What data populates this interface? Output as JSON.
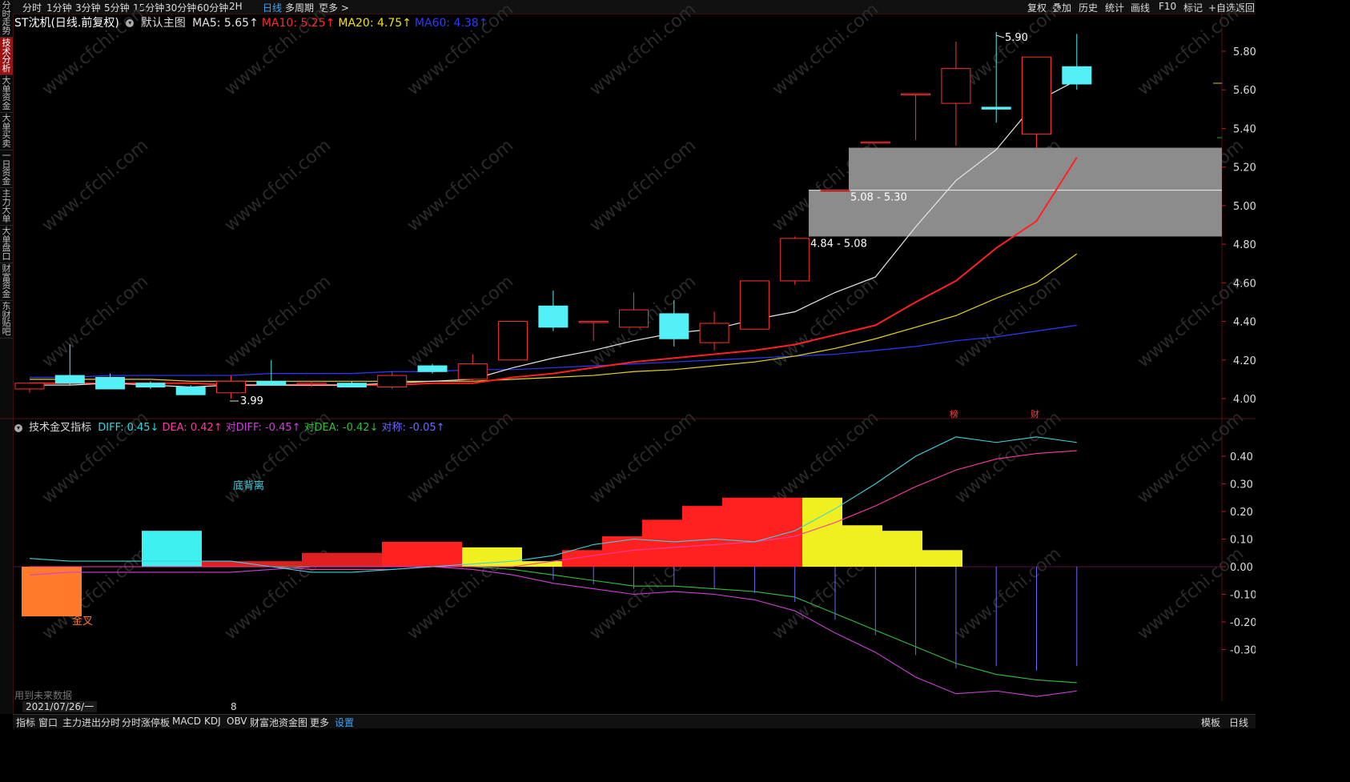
{
  "sidebar": {
    "tabs": [
      {
        "label": "分时走势",
        "active": false
      },
      {
        "label": "技术分析",
        "active": true
      },
      {
        "label": "大单资金",
        "active": false
      },
      {
        "label": "大单买卖",
        "active": false
      },
      {
        "label": "一日资金",
        "active": false
      },
      {
        "label": "主力大单",
        "active": false
      },
      {
        "label": "大单盘口",
        "active": false
      },
      {
        "label": "财富资金",
        "active": false
      },
      {
        "label": "东财贴吧",
        "active": false
      }
    ]
  },
  "toolbar": {
    "periods": [
      "分时",
      "1分钟",
      "3分钟",
      "5分钟",
      "15分钟",
      "30分钟",
      "60分钟",
      "2H",
      "日线",
      "多周期",
      "更多 >"
    ],
    "active_period": "日线",
    "right_tools": [
      "复权",
      "叠加",
      "历史",
      "统计",
      "画线",
      "F10",
      "标记",
      "+自选",
      "返回"
    ]
  },
  "main_chart": {
    "title": "ST沈机(日线.前复权)",
    "indicator_name": "默认主图",
    "ma": [
      {
        "label": "MA5: 5.65",
        "color": "#e6e6e6"
      },
      {
        "label": "MA10: 5.25",
        "color": "#ff2a2a"
      },
      {
        "label": "MA20: 4.75",
        "color": "#f3e01a"
      },
      {
        "label": "MA60: 4.38",
        "color": "#2b3bff"
      }
    ],
    "y_ticks": [
      "5.80",
      "5.60",
      "5.40",
      "5.20",
      "5.00",
      "4.80",
      "4.60",
      "4.40",
      "4.20",
      "4.00"
    ],
    "max_label": "5.90",
    "min_label": "3.99",
    "zone_labels": [
      "5.08 - 5.30",
      "4.84 - 5.08"
    ],
    "markers": [
      "榜",
      "财"
    ]
  },
  "sub_chart": {
    "title": "技术金叉指标",
    "values": [
      {
        "label": "DIFF: 0.45",
        "color": "#3ad4e0"
      },
      {
        "label": "DEA: 0.42",
        "color": "#ff3aa0"
      },
      {
        "label": "对DIFF: -0.45",
        "color": "#d040d8"
      },
      {
        "label": "对DEA: -0.42",
        "color": "#30c040"
      },
      {
        "label": "对称: -0.05",
        "color": "#6b6bff"
      }
    ],
    "y_ticks": [
      "0.40",
      "0.30",
      "0.20",
      "0.10",
      "0.00",
      "-0.10",
      "-0.20",
      "-0.30"
    ],
    "annotations": {
      "divergence": "底背离",
      "golden_cross": "金叉"
    }
  },
  "footer": {
    "future_note": "用到未来数据",
    "date": "2021/07/26/一",
    "date_tick": "8",
    "tabs": [
      "指标",
      "窗口",
      "主力进出分时",
      "分时涨停板",
      "MACD",
      "KDJ",
      "OBV",
      "财富池资金图",
      "更多",
      "设置"
    ],
    "active_tab": "设置",
    "right_labels": [
      "模板",
      "日线"
    ]
  },
  "watermark": "www.cfchi.com",
  "chart_data": [
    {
      "type": "candlestick",
      "title": "ST沈机(日线.前复权)",
      "ylim": [
        3.95,
        5.95
      ],
      "ohlc": [
        [
          4.05,
          4.08,
          4.03,
          4.08
        ],
        [
          4.12,
          4.28,
          4.07,
          4.08
        ],
        [
          4.11,
          4.13,
          4.05,
          4.05
        ],
        [
          4.08,
          4.09,
          4.05,
          4.06
        ],
        [
          4.06,
          4.07,
          4.02,
          4.02
        ],
        [
          4.03,
          4.12,
          4.0,
          4.09
        ],
        [
          4.09,
          4.2,
          4.07,
          4.07
        ],
        [
          4.08,
          4.09,
          4.06,
          4.08
        ],
        [
          4.08,
          4.09,
          4.06,
          4.06
        ],
        [
          4.06,
          4.14,
          4.05,
          4.12
        ],
        [
          4.17,
          4.18,
          4.13,
          4.14
        ],
        [
          4.1,
          4.23,
          4.09,
          4.18
        ],
        [
          4.2,
          4.4,
          4.2,
          4.4
        ],
        [
          4.48,
          4.56,
          4.35,
          4.37
        ],
        [
          4.4,
          4.4,
          4.3,
          4.4
        ],
        [
          4.37,
          4.55,
          4.37,
          4.46
        ],
        [
          4.44,
          4.51,
          4.27,
          4.31
        ],
        [
          4.29,
          4.45,
          4.25,
          4.39
        ],
        [
          4.36,
          4.6,
          4.36,
          4.61
        ],
        [
          4.61,
          4.84,
          4.59,
          4.83
        ],
        [
          5.08,
          5.08,
          5.08,
          5.08
        ],
        [
          5.33,
          5.33,
          5.33,
          5.33
        ],
        [
          5.58,
          5.58,
          5.34,
          5.58
        ],
        [
          5.53,
          5.85,
          5.31,
          5.71
        ],
        [
          5.51,
          5.9,
          5.43,
          5.5
        ],
        [
          5.37,
          5.77,
          5.3,
          5.77
        ],
        [
          5.72,
          5.89,
          5.6,
          5.63
        ]
      ],
      "ma5": [
        4.07,
        4.07,
        4.08,
        4.07,
        4.06,
        4.07,
        4.07,
        4.07,
        4.07,
        4.08,
        4.09,
        4.1,
        4.16,
        4.21,
        4.25,
        4.3,
        4.34,
        4.36,
        4.41,
        4.45,
        4.55,
        4.63,
        4.89,
        5.13,
        5.29,
        5.54,
        5.65
      ],
      "ma10": [
        4.08,
        4.08,
        4.08,
        4.08,
        4.08,
        4.07,
        4.07,
        4.07,
        4.07,
        4.07,
        4.08,
        4.08,
        4.11,
        4.13,
        4.16,
        4.19,
        4.21,
        4.23,
        4.25,
        4.28,
        4.33,
        4.38,
        4.5,
        4.61,
        4.78,
        4.92,
        5.25
      ],
      "ma20": [
        4.1,
        4.1,
        4.1,
        4.1,
        4.09,
        4.09,
        4.09,
        4.09,
        4.09,
        4.09,
        4.09,
        4.09,
        4.1,
        4.11,
        4.12,
        4.14,
        4.15,
        4.17,
        4.19,
        4.22,
        4.26,
        4.31,
        4.37,
        4.43,
        4.52,
        4.6,
        4.75
      ],
      "ma60": [
        4.11,
        4.11,
        4.12,
        4.12,
        4.12,
        4.12,
        4.13,
        4.13,
        4.13,
        4.14,
        4.14,
        4.15,
        4.15,
        4.16,
        4.17,
        4.18,
        4.19,
        4.2,
        4.21,
        4.22,
        4.23,
        4.25,
        4.27,
        4.3,
        4.32,
        4.35,
        4.38
      ]
    },
    {
      "type": "bar",
      "title": "技术金叉指标",
      "ylim": [
        -0.35,
        0.45
      ],
      "bars": [
        {
          "from": 0,
          "to": 3,
          "value": -0.18,
          "color": "#ff7a2a"
        },
        {
          "from": 6,
          "to": 9,
          "value": 0.13,
          "color": "#3ff0f0"
        },
        {
          "from": 9,
          "to": 14,
          "value": 0.02,
          "color": "#e02020"
        },
        {
          "from": 14,
          "to": 18,
          "value": 0.05,
          "color": "#e02020"
        },
        {
          "from": 18,
          "to": 22,
          "value": 0.09,
          "color": "#ff2020"
        },
        {
          "from": 22,
          "to": 25,
          "value": 0.07,
          "color": "#f0f020"
        },
        {
          "from": 25,
          "to": 27,
          "value": 0.02,
          "color": "#f0f020"
        },
        {
          "from": 27,
          "to": 29,
          "value": 0.06,
          "color": "#ff2020"
        },
        {
          "from": 29,
          "to": 31,
          "value": 0.11,
          "color": "#ff2020"
        },
        {
          "from": 31,
          "to": 33,
          "value": 0.17,
          "color": "#ff2020"
        },
        {
          "from": 33,
          "to": 35,
          "value": 0.22,
          "color": "#ff2020"
        },
        {
          "from": 35,
          "to": 37,
          "value": 0.25,
          "color": "#ff2020"
        },
        {
          "from": 37,
          "to": 39,
          "value": 0.25,
          "color": "#ff2020"
        },
        {
          "from": 39,
          "to": 41,
          "value": 0.25,
          "color": "#f0f020"
        },
        {
          "from": 41,
          "to": 43,
          "value": 0.15,
          "color": "#f0f020"
        },
        {
          "from": 43,
          "to": 45,
          "value": 0.13,
          "color": "#f0f020"
        },
        {
          "from": 45,
          "to": 47,
          "value": 0.06,
          "color": "#f0f020"
        }
      ],
      "diff": [
        0.03,
        0.02,
        0.02,
        0.02,
        0.02,
        0.02,
        0.0,
        -0.02,
        -0.02,
        -0.01,
        0.0,
        0.01,
        0.02,
        0.04,
        0.08,
        0.1,
        0.09,
        0.1,
        0.09,
        0.13,
        0.21,
        0.3,
        0.4,
        0.47,
        0.45,
        0.47,
        0.45
      ],
      "dea": [
        0.0,
        0.0,
        0.0,
        0.0,
        0.0,
        0.0,
        0.0,
        -0.01,
        -0.01,
        -0.01,
        0.0,
        0.0,
        0.0,
        0.02,
        0.04,
        0.06,
        0.07,
        0.08,
        0.09,
        0.11,
        0.16,
        0.22,
        0.29,
        0.35,
        0.39,
        0.41,
        0.42
      ],
      "ddiff": [
        -0.03,
        -0.02,
        -0.02,
        -0.02,
        -0.02,
        -0.02,
        -0.01,
        0.0,
        0.0,
        0.0,
        0.0,
        -0.01,
        -0.03,
        -0.06,
        -0.08,
        -0.1,
        -0.09,
        -0.1,
        -0.12,
        -0.16,
        -0.24,
        -0.31,
        -0.4,
        -0.46,
        -0.45,
        -0.47,
        -0.45
      ],
      "ddea": [
        0.0,
        0.0,
        0.0,
        0.0,
        0.0,
        0.0,
        0.0,
        0.0,
        0.0,
        0.0,
        0.0,
        0.0,
        -0.01,
        -0.03,
        -0.05,
        -0.07,
        -0.07,
        -0.08,
        -0.09,
        -0.11,
        -0.17,
        -0.23,
        -0.29,
        -0.35,
        -0.39,
        -0.41,
        -0.42
      ]
    }
  ]
}
